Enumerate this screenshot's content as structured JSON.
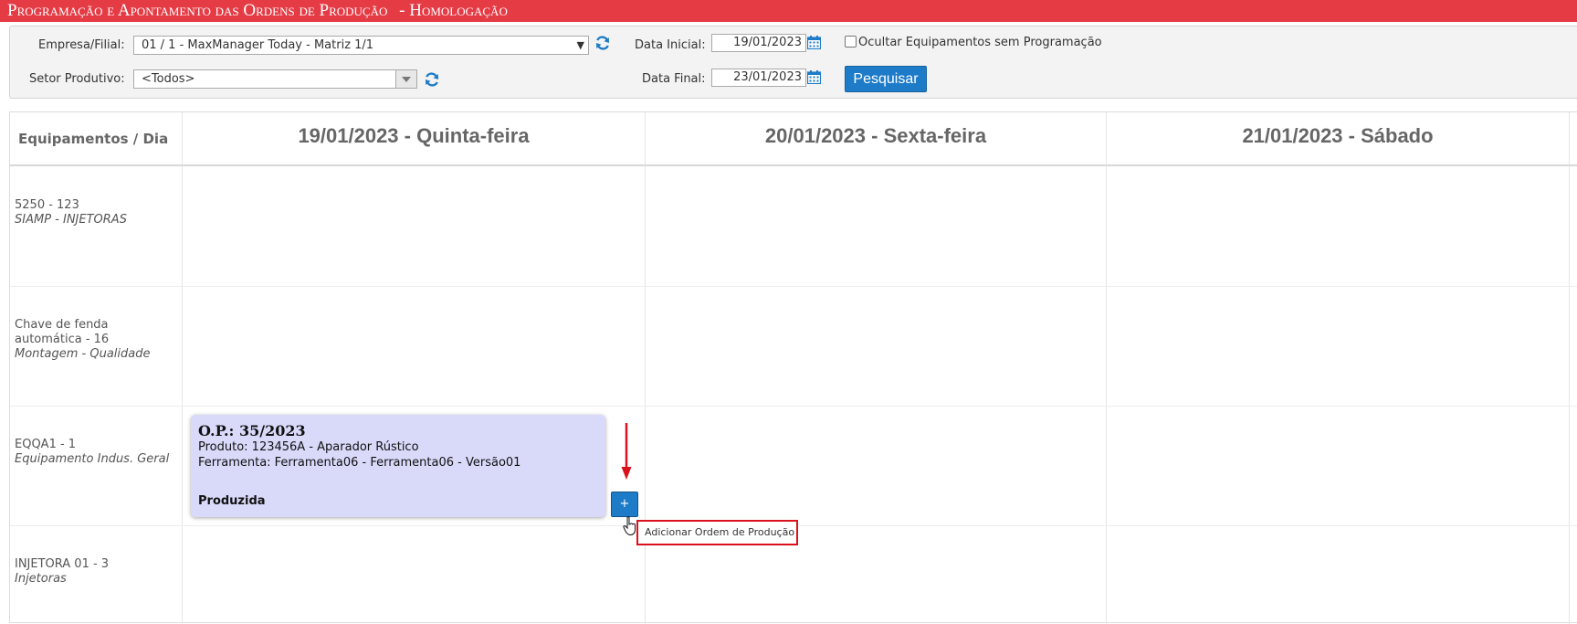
{
  "window": {
    "title": "Programação e Apontamento das Ordens de Produção",
    "env": "- Homologação"
  },
  "filters": {
    "empresa_label": "Empresa/Filial:",
    "empresa_value": "01 / 1 - MaxManager Today - Matriz 1/1",
    "setor_label": "Setor Produtivo:",
    "setor_value": "<Todos>",
    "data_inicial_label": "Data Inicial:",
    "data_inicial_value": "19/01/2023",
    "data_final_label": "Data Final:",
    "data_final_value": "23/01/2023",
    "ocultar_label": "Ocultar Equipamentos sem Programação",
    "pesquisar_label": "Pesquisar"
  },
  "grid": {
    "header_equip": "Equipamentos / Dia",
    "days": [
      "19/01/2023 - Quinta-feira",
      "20/01/2023 - Sexta-feira",
      "21/01/2023 - Sábado"
    ],
    "rows": [
      {
        "lines": [
          "5250 - 123"
        ],
        "subtitle": "SIAMP - INJETORAS"
      },
      {
        "lines": [
          "Chave de fenda",
          "automática - 16"
        ],
        "subtitle": "Montagem - Qualidade"
      },
      {
        "lines": [
          "EQQA1 - 1"
        ],
        "subtitle": "Equipamento Indus. Geral"
      },
      {
        "lines": [
          "INJETORA 01 - 3"
        ],
        "subtitle": "Injetoras"
      }
    ]
  },
  "op_card": {
    "title": "O.P.: 35/2023",
    "produto": "Produto: 123456A - Aparador Rústico",
    "ferramenta": "Ferramenta: Ferramenta06 - Ferramenta06 - Versão01",
    "status": "Produzida"
  },
  "add_button": {
    "label": "+"
  },
  "tooltip": {
    "text": "Adicionar Ordem de Produção"
  },
  "colors": {
    "title_bar": "#e53b45",
    "accent_button": "#1d7bc8",
    "card_bg": "#d9dafa",
    "annotation": "#d9131d"
  }
}
